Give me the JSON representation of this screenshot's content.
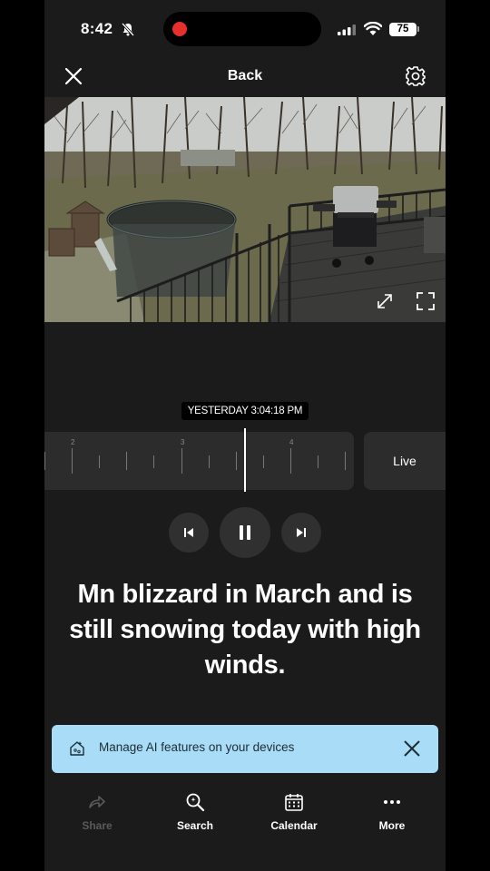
{
  "status_bar": {
    "time": "8:42",
    "battery": "75"
  },
  "nav": {
    "back_label": "Back"
  },
  "player": {
    "timestamp": "YESTERDAY 3:04:18 PM",
    "tick_labels": [
      "2",
      "3",
      "4"
    ],
    "live_label": "Live"
  },
  "caption": {
    "line1": "Mn blizzard in March and is",
    "line2": "still snowing today with high",
    "line3": "winds."
  },
  "ai_banner": {
    "text": "Manage AI features on your devices"
  },
  "tabs": [
    {
      "label": "Share",
      "icon": "share-icon",
      "enabled": false
    },
    {
      "label": "Search",
      "icon": "search-icon",
      "enabled": true
    },
    {
      "label": "Calendar",
      "icon": "calendar-icon",
      "enabled": true
    },
    {
      "label": "More",
      "icon": "more-icon",
      "enabled": true
    }
  ],
  "colors": {
    "background": "#1b1b1b",
    "banner": "#a9dcf6",
    "record_dot": "#e5302c"
  }
}
